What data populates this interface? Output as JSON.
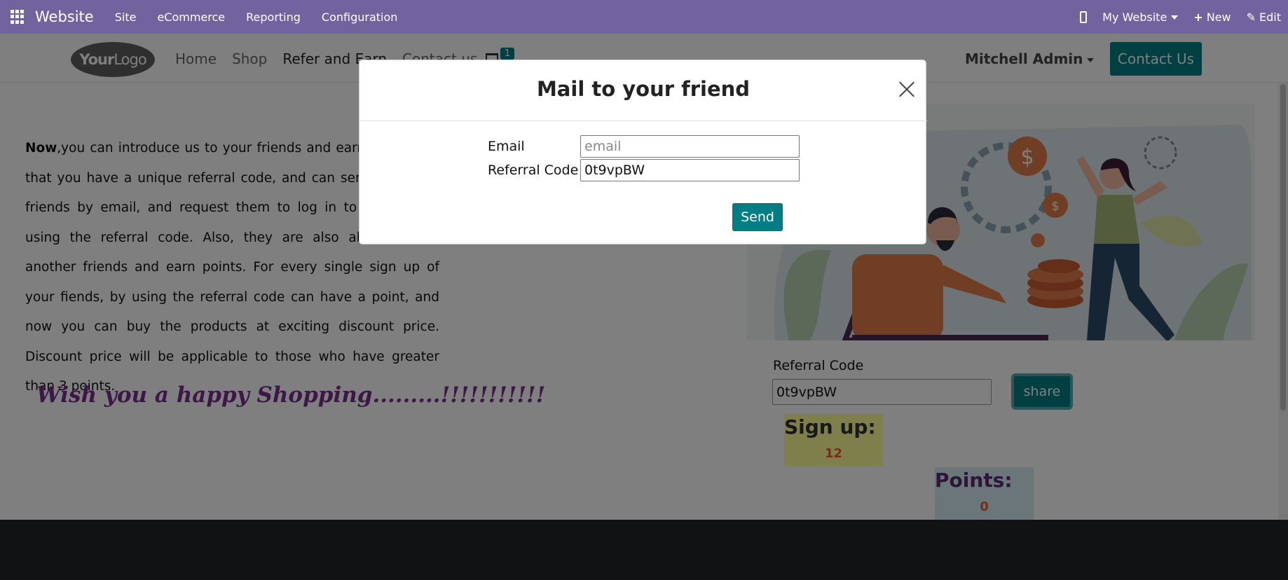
{
  "topbar": {
    "brand": "Website",
    "menu": [
      "Site",
      "eCommerce",
      "Reporting",
      "Configuration"
    ],
    "website_selector": "My Website",
    "new_label": "New",
    "edit_label": "Edit"
  },
  "header": {
    "logo_text_bold": "Your",
    "logo_text_light": "Logo",
    "nav": [
      "Home",
      "Shop",
      "Refer and Earn",
      "Contact us"
    ],
    "cart_count": "1",
    "user_name": "Mitchell Admin",
    "contact_button": "Contact Us"
  },
  "main": {
    "intro_bold": "Now",
    "intro_text": ",you can introduce us to your friends and earn points. For that you have a unique referral code, and can send it to your friends by email, and request them to log in to the site by using the referral code. Also, they are also able to refer another friends and earn points. For every single sign up of your fiends, by using the referral code can have a point, and now you can buy the products at exciting discount price. Discount price will be applicable to those who have greater than 3 points.",
    "wish_text": "Wish you a happy Shopping.........!!!!!!!!!!!",
    "referral_label": "Referral Code",
    "referral_code": "0t9vpBW",
    "share_button": "share",
    "signup_label": "Sign up:",
    "signup_count": "12",
    "points_label": "Points:",
    "points_count": "0"
  },
  "modal": {
    "title": "Mail to your friend",
    "email_label": "Email",
    "email_placeholder": "email",
    "email_value": "",
    "code_label": "Referral Code",
    "code_value": "0t9vpBW",
    "send_button": "Send"
  },
  "colors": {
    "topbar": "#71639e",
    "primary": "#017e84",
    "wish": "#7a2f8e",
    "signup_bg": "#ffff99",
    "points_bg": "#d6ecf4",
    "value_color": "#e65c2e"
  }
}
